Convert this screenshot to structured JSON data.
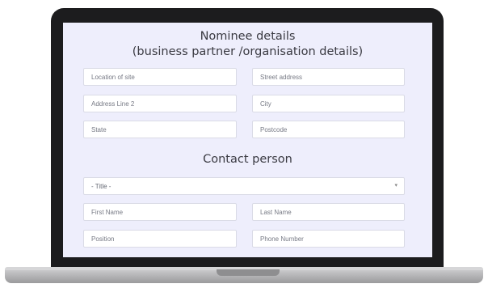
{
  "form": {
    "title_line1": "Nominee details",
    "title_line2": "(business partner /organisation details)",
    "contact_title": "Contact person",
    "fields": {
      "location": "Location of site",
      "street": "Street address",
      "address2": "Address Line 2",
      "city": "City",
      "state": "State",
      "postcode": "Postcode",
      "title_select": "- Title -",
      "first_name": "First Name",
      "last_name": "Last Name",
      "position": "Position",
      "phone": "Phone Number"
    },
    "select_chevron": "▾"
  },
  "colors": {
    "screen_bg": "#eeeefc",
    "bezel": "#1c1c1e"
  }
}
